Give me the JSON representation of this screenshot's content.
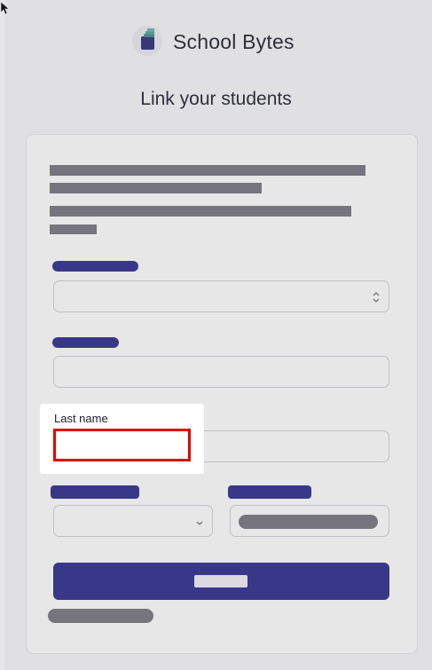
{
  "brand": {
    "name": "School Bytes",
    "logo_icon": "book-stack-icon"
  },
  "page": {
    "title": "Link your students"
  },
  "fields": {
    "last_name": {
      "label": "Last name",
      "value": ""
    }
  },
  "colors": {
    "accent": "#2b2a8a",
    "highlight_border": "#e00000",
    "placeholder_bar": "#76757e"
  }
}
